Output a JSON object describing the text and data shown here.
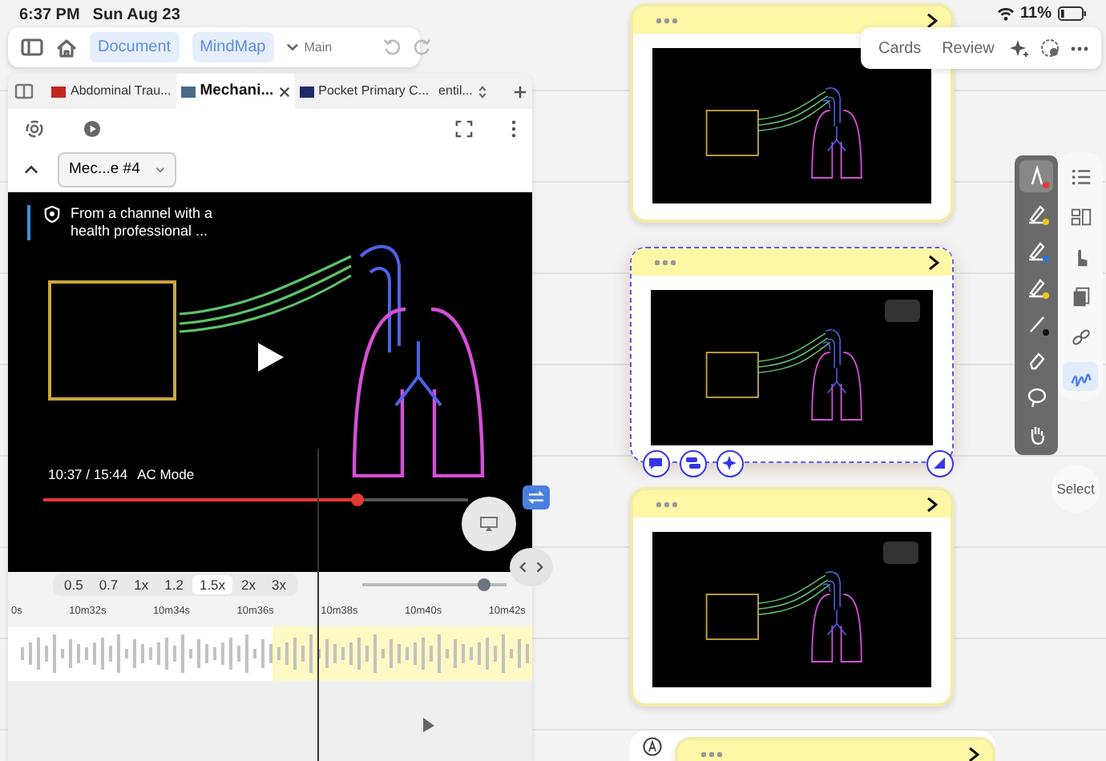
{
  "status_bar": {
    "time": "6:37 PM",
    "date": "Sun Aug 23",
    "battery": "11%"
  },
  "toolbar": {
    "modes": [
      {
        "label": "Document",
        "active": true
      },
      {
        "label": "MindMap",
        "active": true
      }
    ],
    "outline": "Main"
  },
  "tabs": [
    {
      "label": "Abdominal Trau...",
      "selected": false,
      "color": "#c0281e"
    },
    {
      "label": "Mechani...",
      "selected": true,
      "color": "#4a6a8a"
    },
    {
      "label": "Pocket Primary C...",
      "selected": false,
      "color": "#1d2a6b"
    },
    {
      "label": "entil...",
      "selected": false
    }
  ],
  "document_select": "Mec...e #4",
  "video": {
    "notice": "From a channel with a health professional ...",
    "time": "10:37 / 15:44",
    "chapter": "AC Mode",
    "progress": {
      "level": 0.74
    }
  },
  "speeds": [
    {
      "label": "0.5",
      "selected": false
    },
    {
      "label": "0.7",
      "selected": false
    },
    {
      "label": "1x",
      "selected": false
    },
    {
      "label": "1.2",
      "selected": false
    },
    {
      "label": "1.5x",
      "selected": true
    },
    {
      "label": "2x",
      "selected": false
    },
    {
      "label": "3x",
      "selected": false
    }
  ],
  "zoom": {
    "level": 0.85
  },
  "timeline": {
    "ticks": [
      "0s",
      "10m32s",
      "10m34s",
      "10m36s",
      "10m38s",
      "10m40s",
      "10m42s"
    ]
  },
  "card_menu": {
    "items": [
      "Cards",
      "Review"
    ]
  },
  "cards": [
    {
      "selected": false,
      "play_overlay": false
    },
    {
      "selected": true,
      "play_overlay": true
    },
    {
      "selected": false,
      "play_overlay": true
    },
    {
      "selected": false
    }
  ],
  "pen_tools": [
    {
      "kind": "pen",
      "selected": true,
      "color": "#e53935"
    },
    {
      "kind": "highlighter",
      "selected": false,
      "color": "#f0c419"
    },
    {
      "kind": "highlighter",
      "selected": false,
      "color": "#2a6ee8"
    },
    {
      "kind": "highlighter",
      "selected": false,
      "color": "#f0c419"
    },
    {
      "kind": "line",
      "selected": false,
      "color": "#111111"
    },
    {
      "kind": "eraser",
      "selected": false
    },
    {
      "kind": "lasso",
      "selected": false
    },
    {
      "kind": "hand",
      "selected": false
    }
  ],
  "side_tools": [
    {
      "kind": "list",
      "selected": false
    },
    {
      "kind": "layout",
      "selected": false
    },
    {
      "kind": "pointer",
      "selected": false
    },
    {
      "kind": "copy",
      "selected": false
    },
    {
      "kind": "link",
      "selected": false
    },
    {
      "kind": "scribble",
      "selected": true
    }
  ],
  "select_button": "Select"
}
